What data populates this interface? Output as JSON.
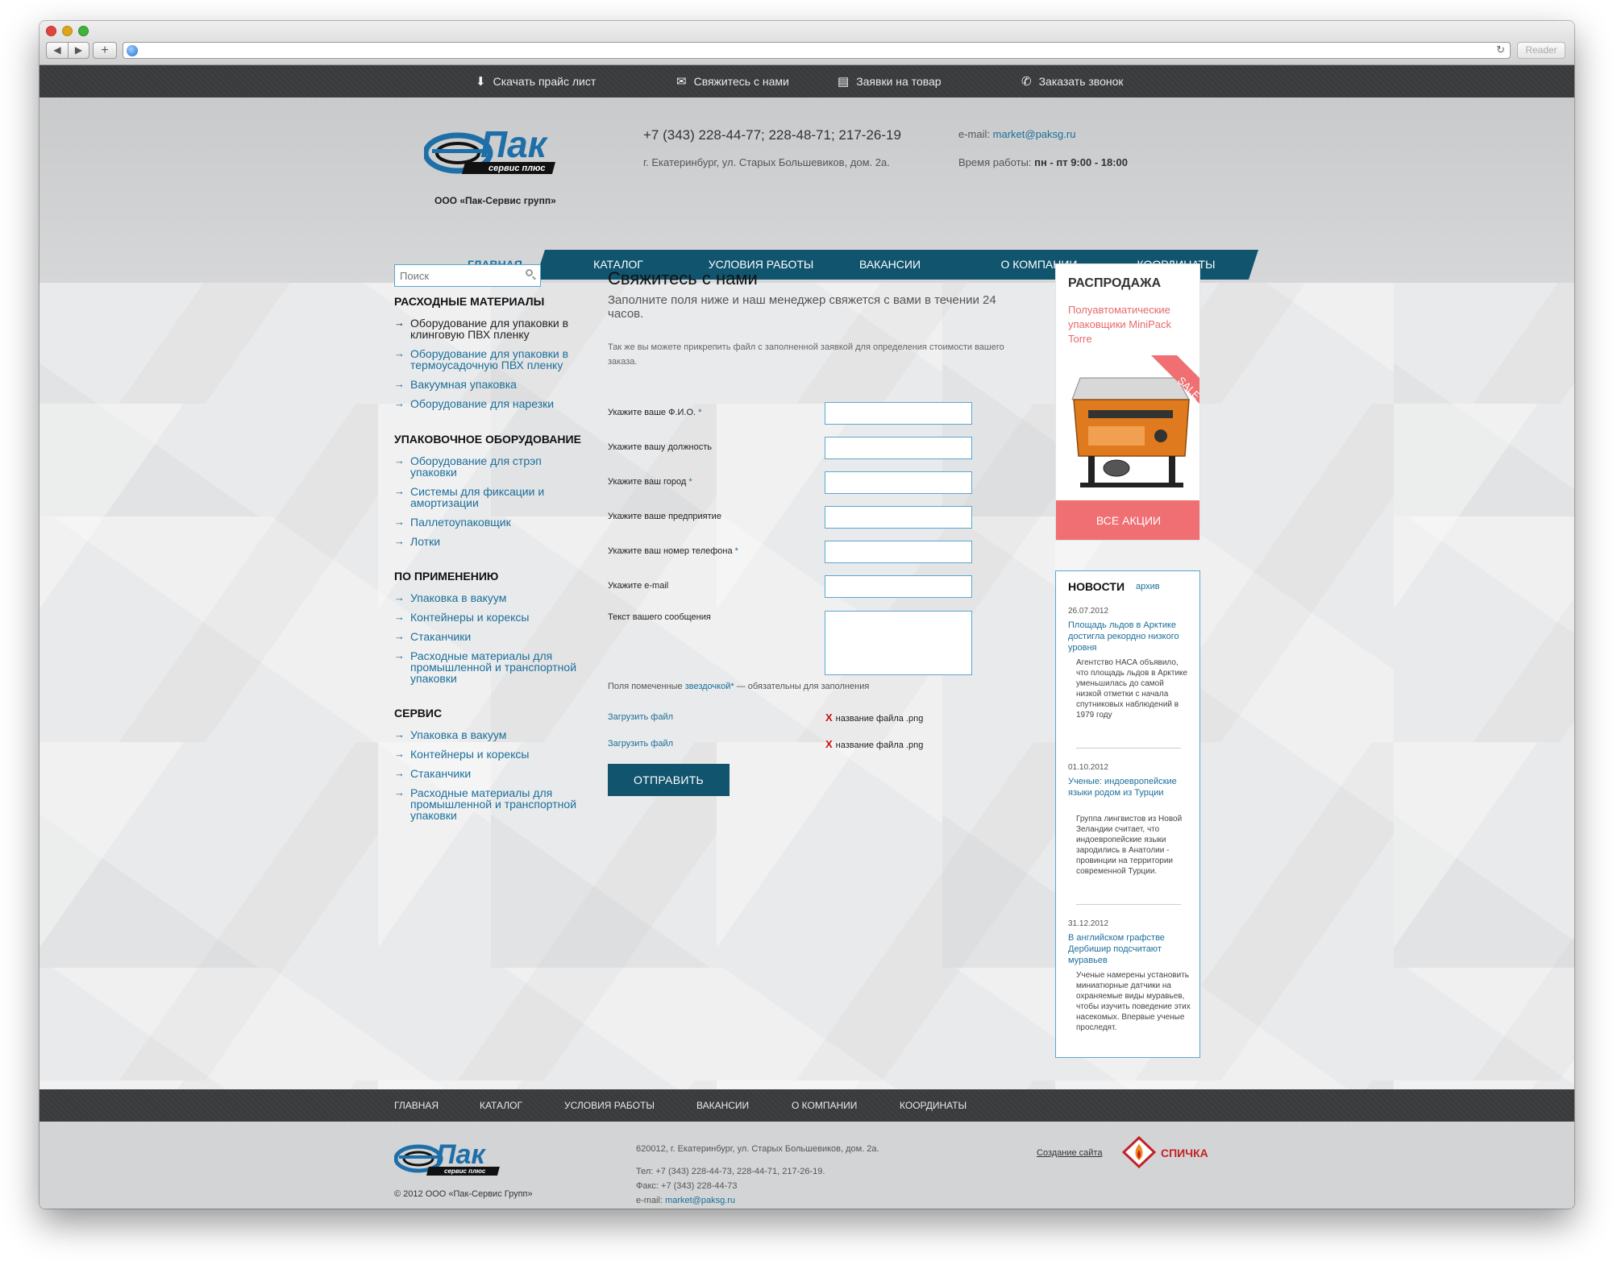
{
  "browser": {
    "reader_label": "Reader"
  },
  "topbar": {
    "links": [
      {
        "label": "Скачать прайс лист",
        "icon": "download-icon"
      },
      {
        "label": "Свяжитесь с нами",
        "icon": "envelope-icon"
      },
      {
        "label": "Заявки на товар",
        "icon": "clipboard-icon"
      },
      {
        "label": "Заказать звонок",
        "icon": "phone-icon"
      }
    ]
  },
  "header": {
    "logo_text": "Пак",
    "logo_subtext": "сервис плюс",
    "company_name": "ООО «Пак-Сервис групп»",
    "phones": "+7 (343) 228-44-77; 228-48-71; 217-26-19",
    "address": "г. Екатеринбург, ул. Старых Большевиков, дом. 2а.",
    "email_label": "e-mail:",
    "email": "market@paksg.ru",
    "hours_label": "Время работы:",
    "hours": "пн - пт 9:00 - 18:00"
  },
  "nav": {
    "items": [
      "Главная",
      "Каталог",
      "Условия работы",
      "Вакансии",
      "О компании",
      "Координаты"
    ],
    "active_index": 0
  },
  "sidebar": {
    "search_placeholder": "Поиск",
    "sections": [
      {
        "title": "Расходные материалы",
        "items": [
          "Оборудование для упаковки в клинговую ПВХ пленку",
          "Оборудование для упаковки в термоусадочную ПВХ пленку",
          "Вакуумная упаковка",
          "Оборудование для нарезки"
        ]
      },
      {
        "title": "Упаковочное оборудование",
        "items": [
          "Оборудование для стрэп упаковки",
          "Системы для фиксации и амортизации",
          "Паллетоупаковщик",
          "Лотки"
        ]
      },
      {
        "title": "По применению",
        "items": [
          "Упаковка в вакуум",
          "Контейнеры и корексы",
          "Стаканчики",
          "Расходные материалы для промышленной и транспортной упаковки"
        ]
      },
      {
        "title": "Сервис",
        "items": [
          "Упаковка в вакуум",
          "Контейнеры и корексы",
          "Стаканчики",
          "Расходные материалы для промышленной и транспортной упаковки"
        ]
      }
    ]
  },
  "content": {
    "title": "Свяжитесь с нами",
    "lead": "Заполните поля ниже и наш менеджер свяжется с вами в течении 24 часов.",
    "note": "Так же вы можете прикрепить файл с заполненной заявкой для определения стоимости вашего заказа.",
    "fields": [
      {
        "label": "Укажите ваше Ф.И.О.",
        "required": "*"
      },
      {
        "label": "Укажите вашу должность",
        "required": ""
      },
      {
        "label": "Укажите ваш город",
        "required": "*"
      },
      {
        "label": "Укажите ваше предприятие",
        "required": ""
      },
      {
        "label": "Укажите ваш номер телефона",
        "required": "*"
      },
      {
        "label": "Укажите e-mail",
        "required": ""
      },
      {
        "label": "Текст вашего сообщения",
        "required": ""
      }
    ],
    "req_note_prefix": "Поля помеченные ",
    "req_note_link": "звездочкой*",
    "req_note_suffix": " — обязательны для заполнения",
    "uploads": [
      {
        "link": "Загрузить файл",
        "remove": "X",
        "filename": "название файла .png"
      },
      {
        "link": "Загрузить файл",
        "remove": "X",
        "filename": "название файла .png"
      }
    ],
    "submit_label": "ОТПРАВИТЬ"
  },
  "sale": {
    "title": "РАСПРОДАЖА",
    "description": "Полуавтоматические упаковщики MiniPack Torre",
    "ribbon": "SALE",
    "button": "ВСЕ АКЦИИ"
  },
  "news": {
    "title": "НОВОСТИ",
    "archive": "архив",
    "items": [
      {
        "date": "26.07.2012",
        "headline": "Площадь льдов в Арктике достигла рекордно низкого уровня",
        "text": "Агентство НАСА объявило, что площадь льдов в Арктике уменьшилась до самой низкой отметки с начала спутниковых наблюдений в 1979 году"
      },
      {
        "date": "01.10.2012",
        "headline": "Ученые: индоевропейские языки родом из Турции",
        "text": "Группа лингвистов из Новой Зеландии считает, что индоевропейские языки зародились в Анатолии - провинции на территории современной Турции."
      },
      {
        "date": "31.12.2012",
        "headline": "В английском графстве Дербишир подсчитают муравьев",
        "text": "Ученые намерены установить миниатюрные датчики на охраняемые виды муравьев, чтобы изучить поведение этих насекомых. Впервые ученые проследят."
      }
    ]
  },
  "footer": {
    "nav": [
      "Главная",
      "Каталог",
      "Условия работы",
      "Вакансии",
      "О компании",
      "Координаты"
    ],
    "copyright": "© 2012 ООО «Пак-Сервис Групп»",
    "address": "620012, г. Екатеринбург, ул. Старых Большевиков, дом. 2а.",
    "phone": "Тел: +7 (343) 228-44-73, 228-44-71, 217-26-19.",
    "fax": "Факс: +7 (343) 228-44-73",
    "email_label": "e-mail: ",
    "email": "market@paksg.ru",
    "site_by": "Создание сайта",
    "developer": "СПИЧКА"
  },
  "colors": {
    "accent": "#1b6f9b",
    "nav_bg": "#11546e",
    "sale": "#ef6f72",
    "topbar": "#3a3b3d"
  }
}
